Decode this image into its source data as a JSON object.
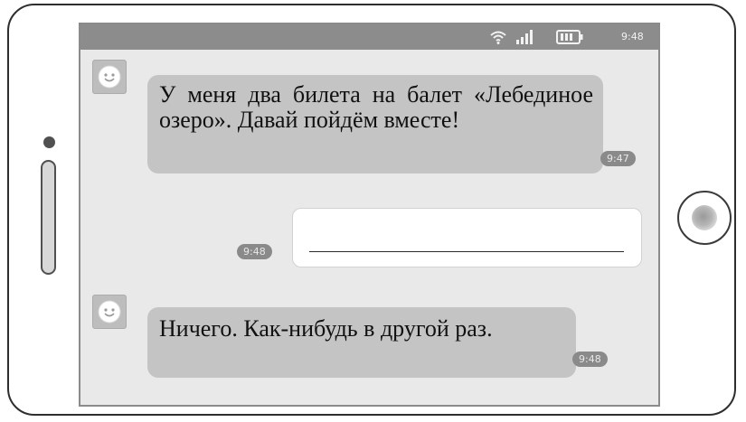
{
  "status_bar": {
    "time": "9:48",
    "icons": [
      "wifi-icon",
      "signal-icon",
      "battery-icon"
    ]
  },
  "messages": [
    {
      "sender": "contact",
      "avatar_icon": "smiley-icon",
      "text": "У меня два билета на балет «Лебединое озеро». Давай пойдём вместе!",
      "time": "9:47"
    },
    {
      "sender": "me",
      "text": "",
      "time": "9:48"
    },
    {
      "sender": "contact",
      "avatar_icon": "smiley-icon",
      "text": "Ничего. Как-нибудь в другой раз.",
      "time": "9:48"
    }
  ],
  "colors": {
    "screen_background": "#e9e9e9",
    "status_bar": "#8c8c8c",
    "incoming_bubble": "#c4c4c4",
    "outgoing_bubble": "#ffffff",
    "time_badge": "#8a8a8a"
  }
}
